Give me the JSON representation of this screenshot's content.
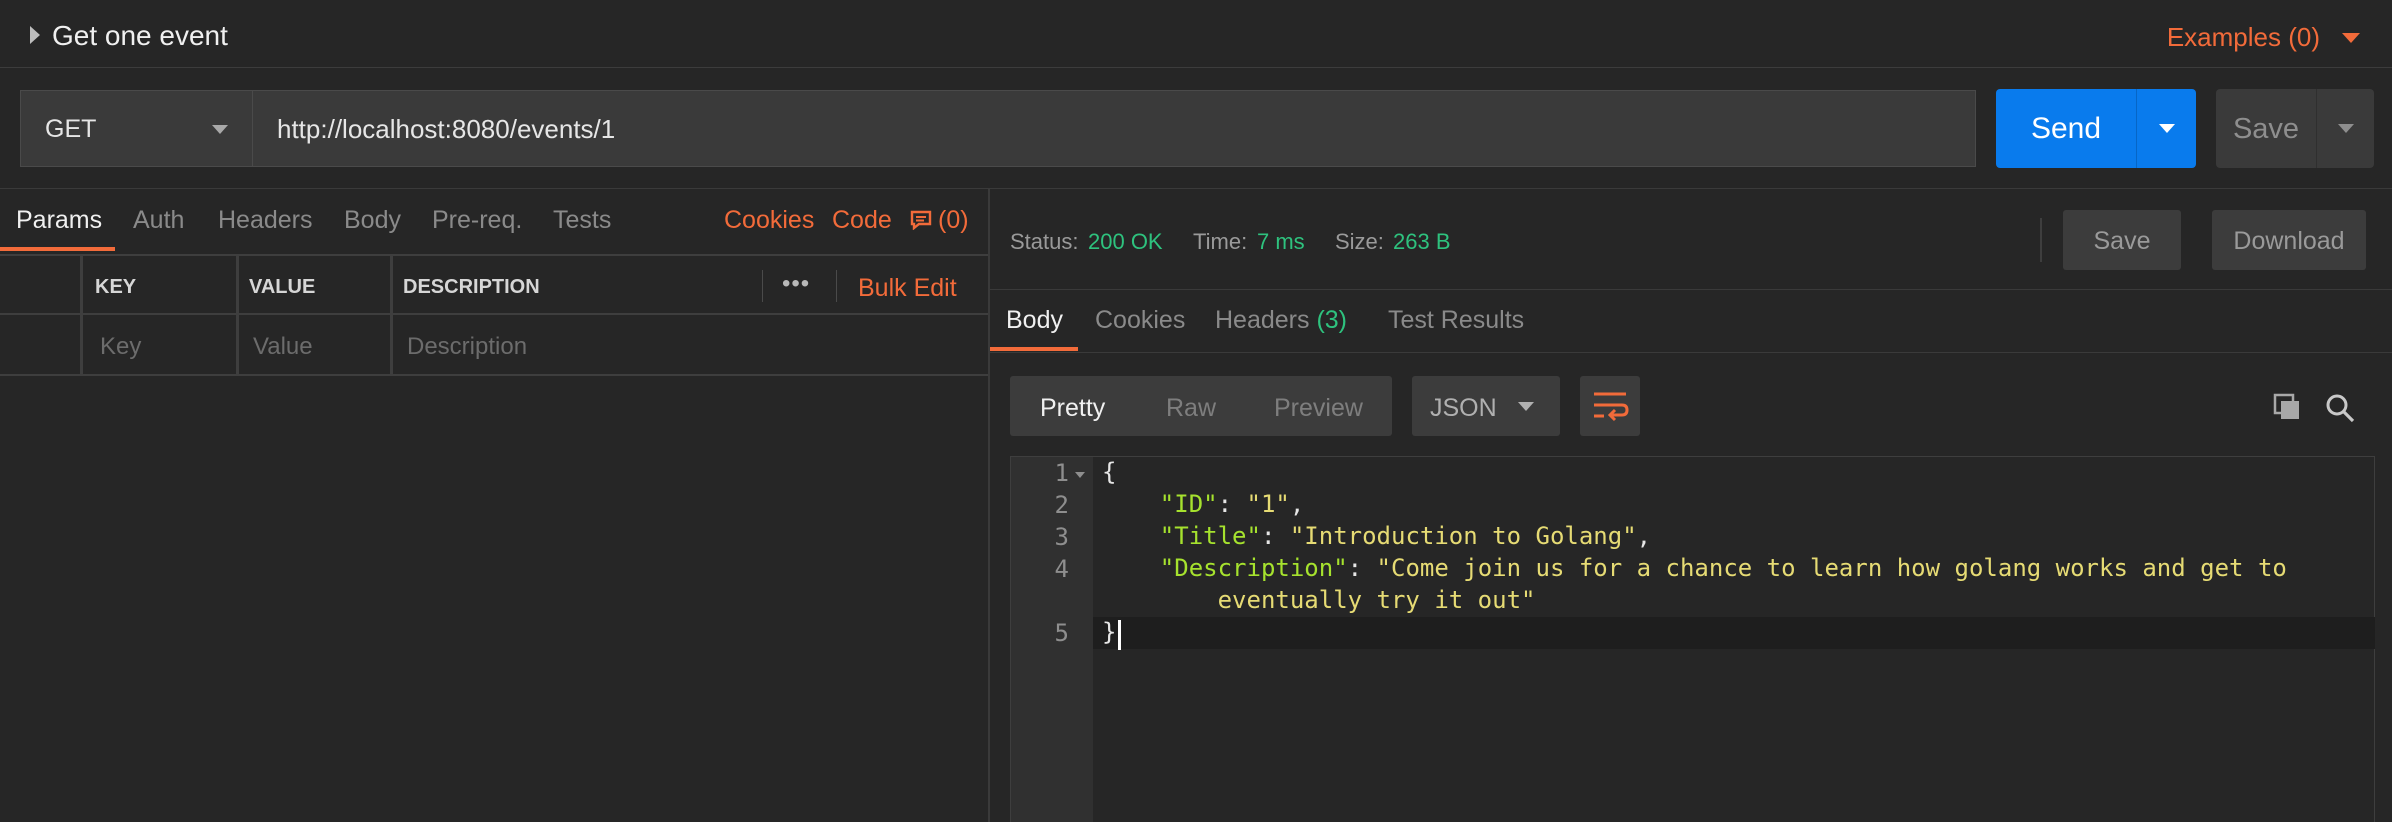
{
  "request": {
    "name": "Get one event",
    "examples_label": "Examples (0)",
    "method": "GET",
    "url": "http://localhost:8080/events/1",
    "send_label": "Send",
    "save_label": "Save"
  },
  "request_tabs": {
    "items": [
      "Params",
      "Auth",
      "Headers",
      "Body",
      "Pre-req.",
      "Tests"
    ],
    "active": "Params",
    "cookies_label": "Cookies",
    "code_label": "Code",
    "comments_count": "(0)"
  },
  "params_table": {
    "headers": [
      "KEY",
      "VALUE",
      "DESCRIPTION"
    ],
    "placeholders": [
      "Key",
      "Value",
      "Description"
    ],
    "more_label": "•••",
    "bulk_edit_label": "Bulk Edit"
  },
  "response": {
    "status_label": "Status:",
    "status_value": "200 OK",
    "time_label": "Time:",
    "time_value": "7 ms",
    "size_label": "Size:",
    "size_value": "263 B",
    "save_label": "Save",
    "download_label": "Download",
    "tabs": {
      "body": "Body",
      "cookies": "Cookies",
      "headers": "Headers",
      "headers_count": "(3)",
      "test_results": "Test Results"
    },
    "view_modes": [
      "Pretty",
      "Raw",
      "Preview"
    ],
    "active_view": "Pretty",
    "format": "JSON",
    "body_lines": [
      {
        "num": "1",
        "text": "{"
      },
      {
        "num": "2",
        "key": "\"ID\"",
        "value": "\"1\"",
        "trail": ","
      },
      {
        "num": "3",
        "key": "\"Title\"",
        "value": "\"Introduction to Golang\"",
        "trail": ","
      },
      {
        "num": "4",
        "key": "\"Description\"",
        "value": "\"Come join us for a chance to learn how golang works and get to",
        "value_cont": "eventually try it out\""
      },
      {
        "num": "5",
        "text": "}"
      }
    ]
  },
  "colors": {
    "accent_orange": "#f26b3a",
    "send_blue": "#097bed",
    "status_green": "#2ec27e",
    "json_key": "#a6e22e",
    "json_string": "#e6db74"
  }
}
